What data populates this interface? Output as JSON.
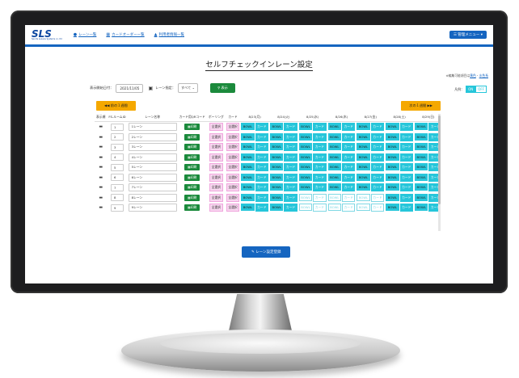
{
  "brand": {
    "logo": "SLS",
    "tagline": "Sports Leisure Systems co. ltd"
  },
  "nav": {
    "items": [
      {
        "icon": "circle-icon",
        "label": "レーン一覧"
      },
      {
        "icon": "building-icon",
        "label": "カードオーダー一覧"
      },
      {
        "icon": "person-icon",
        "label": "利用者情報一覧"
      }
    ],
    "admin_menu": "管理メニュー"
  },
  "page": {
    "title": "セルフチェックインレーン設定",
    "note_prefix": "※編集可能項目は",
    "note_link": "黄色",
    "note_middle": "・",
    "note_link2": "水色系"
  },
  "filters": {
    "start_date_label": "表示開始日付：",
    "start_date_value": "2021/11/05",
    "lane_label": "レーン指定：",
    "lane_value": "すべて",
    "show_button": "表示"
  },
  "legend": {
    "label": "凡例：",
    "on": "ON",
    "off": "OFF"
  },
  "week_nav": {
    "prev": "前の１週間",
    "next": "次の１週間"
  },
  "table": {
    "headers": [
      "表示順",
      "FS-ルームID",
      "レーン名称",
      "カード用QRコード",
      "ボーリング",
      "カード",
      "8/23(月)",
      "8/24(火)",
      "8/25(水)",
      "8/26(木)",
      "8/27(金)",
      "8/28(土)",
      "8/29(日)"
    ],
    "qr_label": "印刷",
    "all_select": "全選択",
    "bowl": "BOWL",
    "card": "カード",
    "rows": [
      {
        "id": "1",
        "name": "1レーン",
        "days": [
          [
            1,
            1
          ],
          [
            1,
            1
          ],
          [
            1,
            1
          ],
          [
            1,
            1
          ],
          [
            1,
            1
          ],
          [
            1,
            1
          ],
          [
            1,
            1
          ]
        ]
      },
      {
        "id": "2",
        "name": "2レーン",
        "days": [
          [
            1,
            1
          ],
          [
            1,
            1
          ],
          [
            1,
            1
          ],
          [
            1,
            1
          ],
          [
            1,
            1
          ],
          [
            1,
            1
          ],
          [
            1,
            1
          ]
        ]
      },
      {
        "id": "3",
        "name": "3レーン",
        "days": [
          [
            1,
            1
          ],
          [
            1,
            1
          ],
          [
            1,
            1
          ],
          [
            1,
            1
          ],
          [
            1,
            1
          ],
          [
            1,
            1
          ],
          [
            1,
            1
          ]
        ]
      },
      {
        "id": "4",
        "name": "4レーン",
        "days": [
          [
            1,
            1
          ],
          [
            1,
            1
          ],
          [
            1,
            1
          ],
          [
            1,
            1
          ],
          [
            1,
            1
          ],
          [
            1,
            1
          ],
          [
            1,
            1
          ]
        ]
      },
      {
        "id": "5",
        "name": "5レーン",
        "days": [
          [
            1,
            1
          ],
          [
            1,
            1
          ],
          [
            1,
            1
          ],
          [
            1,
            1
          ],
          [
            1,
            1
          ],
          [
            1,
            1
          ],
          [
            1,
            1
          ]
        ]
      },
      {
        "id": "6",
        "name": "6レーン",
        "days": [
          [
            1,
            1
          ],
          [
            1,
            1
          ],
          [
            1,
            1
          ],
          [
            1,
            1
          ],
          [
            1,
            1
          ],
          [
            1,
            1
          ],
          [
            1,
            1
          ]
        ]
      },
      {
        "id": "7",
        "name": "7レーン",
        "days": [
          [
            1,
            1
          ],
          [
            1,
            1
          ],
          [
            1,
            1
          ],
          [
            1,
            1
          ],
          [
            1,
            1
          ],
          [
            1,
            1
          ],
          [
            1,
            1
          ]
        ]
      },
      {
        "id": "8",
        "name": "8レーン",
        "days": [
          [
            1,
            1
          ],
          [
            1,
            1
          ],
          [
            0,
            0
          ],
          [
            0,
            0
          ],
          [
            0,
            0
          ],
          [
            1,
            1
          ],
          [
            1,
            1
          ]
        ]
      },
      {
        "id": "9",
        "name": "9レーン",
        "days": [
          [
            1,
            1
          ],
          [
            1,
            1
          ],
          [
            0,
            0
          ],
          [
            0,
            0
          ],
          [
            0,
            0
          ],
          [
            1,
            1
          ],
          [
            1,
            1
          ]
        ]
      }
    ]
  },
  "register_button": "レーン設定登録"
}
